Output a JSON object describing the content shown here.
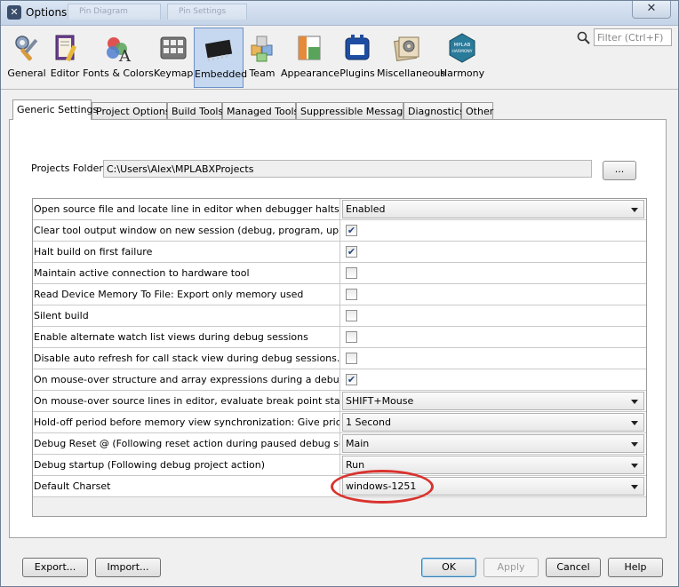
{
  "window": {
    "title": "Options",
    "ghost_tabs": [
      "Pin Diagram",
      "Pin Settings"
    ]
  },
  "toolbar": {
    "items": [
      {
        "label": "General",
        "icon": "general-icon"
      },
      {
        "label": "Editor",
        "icon": "editor-icon"
      },
      {
        "label": "Fonts & Colors",
        "icon": "fonts-colors-icon"
      },
      {
        "label": "Keymap",
        "icon": "keymap-icon"
      },
      {
        "label": "Embedded",
        "icon": "embedded-icon",
        "selected": true
      },
      {
        "label": "Team",
        "icon": "team-icon"
      },
      {
        "label": "Appearance",
        "icon": "appearance-icon"
      },
      {
        "label": "Plugins",
        "icon": "plugins-icon"
      },
      {
        "label": "Miscellaneous",
        "icon": "miscellaneous-icon"
      },
      {
        "label": "Harmony",
        "icon": "harmony-icon"
      }
    ],
    "filter_placeholder": "Filter (Ctrl+F)"
  },
  "tabs": [
    {
      "label": "Generic Settings",
      "active": true
    },
    {
      "label": "Project Options"
    },
    {
      "label": "Build Tools"
    },
    {
      "label": "Managed Tools"
    },
    {
      "label": "Suppressible Messages"
    },
    {
      "label": "Diagnostics"
    },
    {
      "label": "Other"
    }
  ],
  "projects_folder": {
    "label": "Projects Folder:",
    "value": "C:\\Users\\Alex\\MPLABXProjects",
    "browse_label": "..."
  },
  "properties": [
    {
      "name": "Open source file and locate line in editor when debugger halts",
      "type": "combo",
      "value": "Enabled"
    },
    {
      "name": "Clear tool output window on new session (debug, program, upload)",
      "type": "check",
      "checked": true
    },
    {
      "name": "Halt build on first failure",
      "type": "check",
      "checked": true
    },
    {
      "name": "Maintain active connection to hardware tool",
      "type": "check",
      "checked": false
    },
    {
      "name": "Read Device Memory To File: Export only memory used",
      "type": "check",
      "checked": false
    },
    {
      "name": "Silent build",
      "type": "check",
      "checked": false
    },
    {
      "name": "Enable alternate watch list views during debug sessions",
      "type": "check",
      "checked": false
    },
    {
      "name": "Disable auto refresh for call stack view during debug sessions.",
      "type": "check",
      "checked": false
    },
    {
      "name": "On mouse-over structure and array expressions during a debug sessi...",
      "type": "check",
      "checked": true
    },
    {
      "name": "On mouse-over source lines in editor, evaluate break point status.",
      "type": "combo",
      "value": "SHIFT+Mouse"
    },
    {
      "name": "Hold-off period before memory view synchronization: Give priority to ...",
      "type": "combo",
      "value": "1 Second"
    },
    {
      "name": "Debug Reset @    (Following reset action during paused debug session)",
      "type": "combo",
      "value": "Main"
    },
    {
      "name": "Debug startup    (Following debug project action)",
      "type": "combo",
      "value": "Run"
    },
    {
      "name": "Default Charset",
      "type": "combo",
      "value": "windows-1251"
    }
  ],
  "buttons": {
    "export": "Export...",
    "import": "Import...",
    "ok": "OK",
    "apply": "Apply",
    "cancel": "Cancel",
    "help": "Help"
  },
  "colors": {
    "highlight_ellipse": "#d9332e",
    "selected_tool": "#c6d8f0"
  }
}
